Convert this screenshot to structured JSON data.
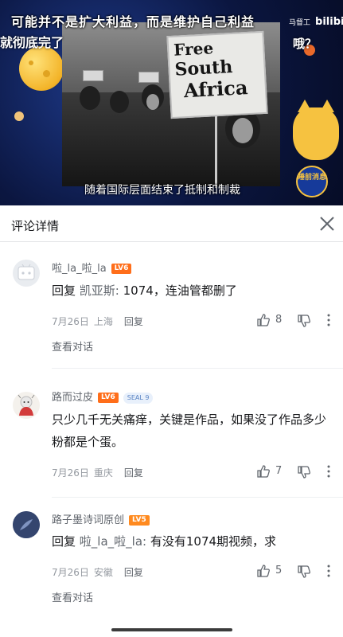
{
  "video": {
    "caption_top": "可能并不是扩大利益，而是维护自己利益",
    "caption_top_line2": "就彻底完了",
    "caption_right": "哦？",
    "caption_bottom": "随着国际层面结束了抵制和制裁",
    "brand_name": "马督工",
    "brand_logo": "bilibili",
    "sign_line1": "Free",
    "sign_line2": "South",
    "sign_line3": "Africa",
    "badge_text": "睡前消息"
  },
  "header": {
    "title": "评论详情",
    "close_icon": "close-icon"
  },
  "comments": [
    {
      "username": "啦_la_啦_la",
      "level": "LV6",
      "reply_prefix": "回复",
      "reply_to": "凯亚斯:",
      "text": "1074，连油管都删了",
      "date": "7月26日",
      "location": "上海",
      "reply_label": "回复",
      "likes": "8",
      "view_conversation": "查看对话"
    },
    {
      "username": "路而过皮",
      "level": "LV6",
      "seal": "SEAL 9",
      "text": "只少几千无关痛痒，关键是作品，如果没了作品多少粉都是个蛋。",
      "date": "7月26日",
      "location": "重庆",
      "reply_label": "回复",
      "likes": "7"
    },
    {
      "username": "路子墨诗词原创",
      "level": "LV5",
      "reply_prefix": "回复",
      "reply_to": "啦_la_啦_la:",
      "text": "有没有1074期视频，求",
      "date": "7月26日",
      "location": "安徽",
      "reply_label": "回复",
      "likes": "5",
      "view_conversation": "查看对话"
    }
  ],
  "colors": {
    "level_badge": "#ff6e1a",
    "meta_text": "#9499a0",
    "video_bg": "#0c1a4a"
  }
}
